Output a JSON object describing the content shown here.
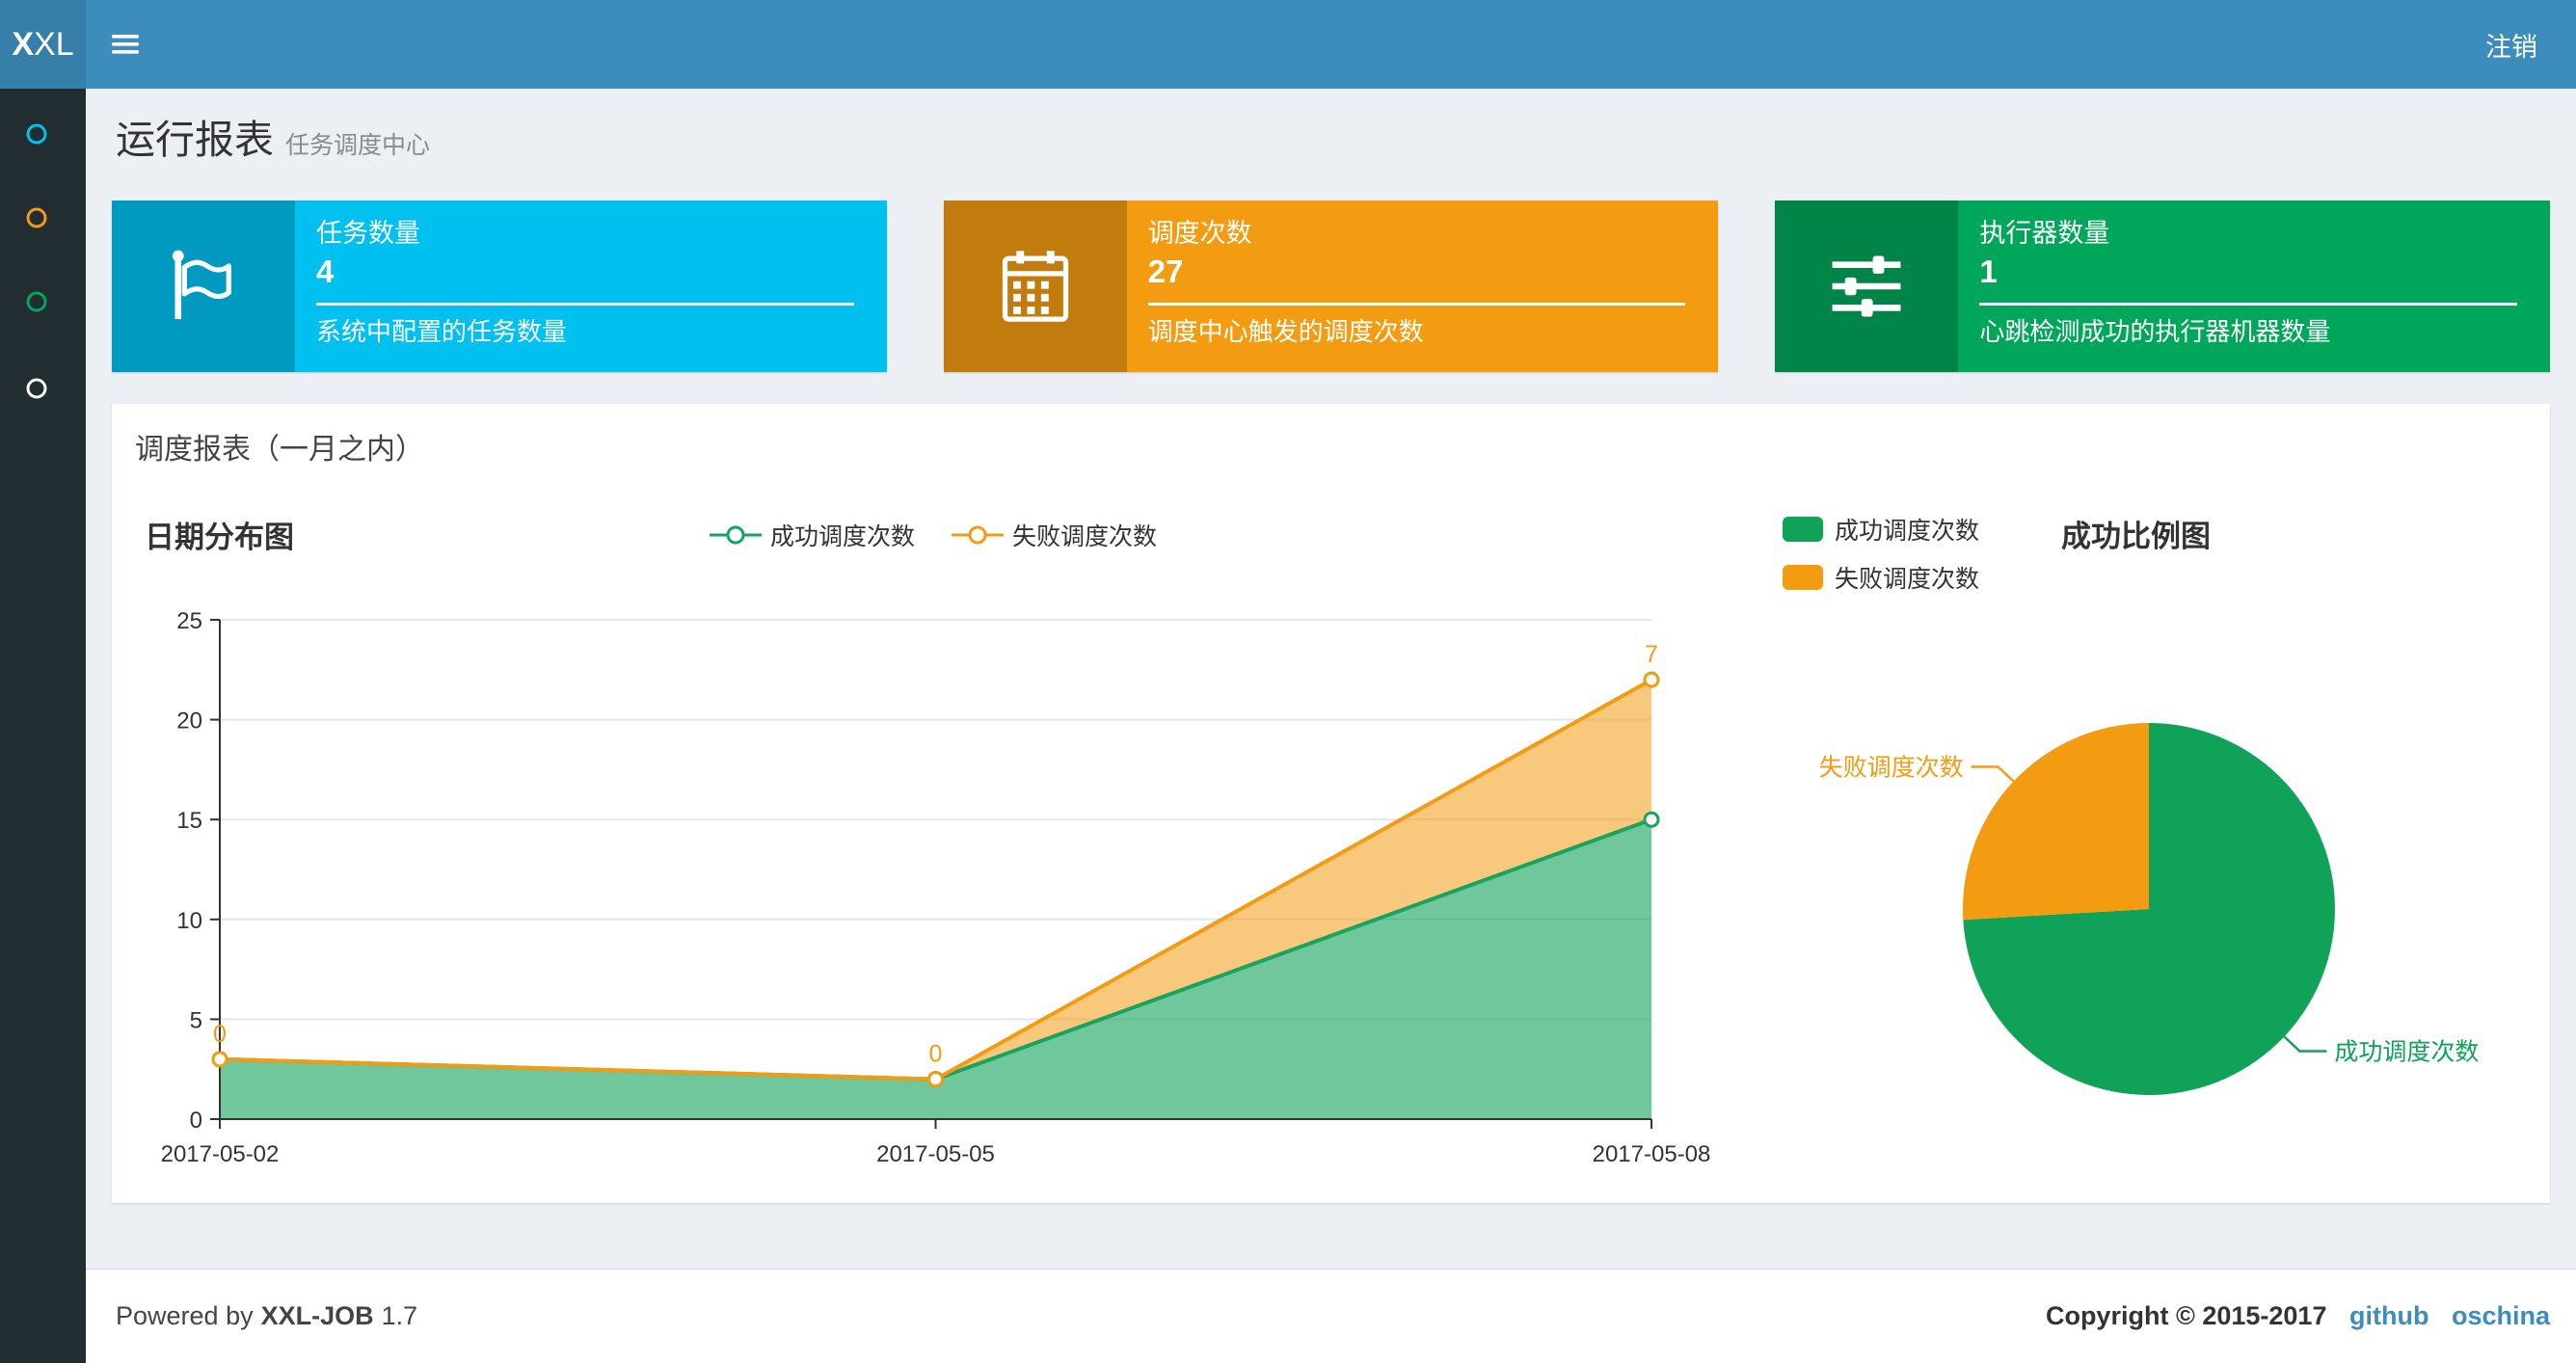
{
  "navbar": {
    "logo_bold": "X",
    "logo_rest": "XL",
    "logout_label": "注销"
  },
  "sidebar": {
    "items": [
      {
        "color": "#00c0ef"
      },
      {
        "color": "#f39c12"
      },
      {
        "color": "#00a65a"
      },
      {
        "color": "#ffffff"
      }
    ]
  },
  "page_header": {
    "title": "运行报表",
    "subtitle": "任务调度中心"
  },
  "info_boxes": [
    {
      "label": "任务数量",
      "value": "4",
      "description": "系统中配置的任务数量",
      "bg": "#00c0ef",
      "icon": "flag-icon"
    },
    {
      "label": "调度次数",
      "value": "27",
      "description": "调度中心触发的调度次数",
      "bg": "#f39c12",
      "icon": "calendar-icon"
    },
    {
      "label": "执行器数量",
      "value": "1",
      "description": "心跳检测成功的执行器机器数量",
      "bg": "#00a65a",
      "icon": "sliders-icon"
    }
  ],
  "panel": {
    "title": "调度报表（一月之内）"
  },
  "chart_data": [
    {
      "type": "area",
      "title": "日期分布图",
      "stacked": true,
      "x": [
        "2017-05-02",
        "2017-05-05",
        "2017-05-08"
      ],
      "series": [
        {
          "name": "成功调度次数",
          "values": [
            3,
            2,
            15
          ],
          "color": "#18a45f",
          "fill": "rgba(24,164,95,0.62)"
        },
        {
          "name": "失败调度次数",
          "values": [
            0,
            0,
            7
          ],
          "color": "#f39c12",
          "fill": "rgba(243,156,18,0.55)",
          "point_labels": [
            "0",
            "0",
            "7"
          ]
        }
      ],
      "ylim": [
        0,
        25
      ],
      "yticks": [
        0,
        5,
        10,
        15,
        20,
        25
      ],
      "grid": true,
      "legend_position": "top"
    },
    {
      "type": "pie",
      "title": "成功比例图",
      "slices": [
        {
          "name": "成功调度次数",
          "value": 20,
          "color": "#0fa258"
        },
        {
          "name": "失败调度次数",
          "value": 7,
          "color": "#f39c12"
        }
      ]
    }
  ],
  "footer": {
    "powered_by": "Powered by",
    "product": "XXL-JOB",
    "version": "1.7",
    "copyright": "Copyright © 2015-2017",
    "links": [
      {
        "label": "github"
      },
      {
        "label": "oschina"
      }
    ],
    "link_color": "#3c8dbc"
  },
  "colors": {
    "navbar_bg": "#3c8dbc",
    "logo_bg": "#367fa9",
    "sidebar_bg": "#222d32",
    "content_bg": "#ecf0f5"
  }
}
